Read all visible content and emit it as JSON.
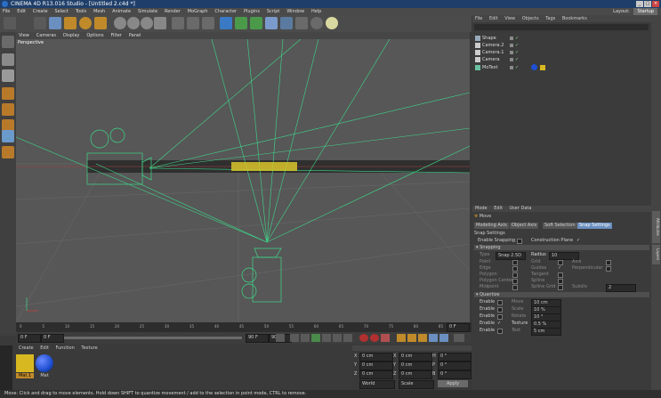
{
  "window": {
    "title": "CINEMA 4D R13.016 Studio - [Untitled 2.c4d *]"
  },
  "menubar": {
    "items": [
      "File",
      "Edit",
      "Create",
      "Select",
      "Tools",
      "Mesh",
      "Animate",
      "Simulate",
      "Render",
      "MoGraph",
      "Character",
      "Plugins",
      "Script",
      "Window",
      "Help"
    ],
    "layout_label": "Layout:",
    "layout_value": "Startup"
  },
  "viewport": {
    "menu": [
      "View",
      "Cameras",
      "Display",
      "Options",
      "Filter",
      "Panel"
    ],
    "label": "Perspective"
  },
  "timeline": {
    "ticks": [
      "0",
      "5",
      "10",
      "15",
      "20",
      "25",
      "30",
      "35",
      "40",
      "45",
      "50",
      "55",
      "60",
      "65",
      "70",
      "75",
      "80",
      "85",
      "90"
    ],
    "current_frame": "0 F"
  },
  "transport": {
    "start_field": "0 F",
    "end_field": "90 F",
    "min_field": "0 F",
    "max_field": "90 F"
  },
  "material_manager": {
    "menu": [
      "Create",
      "Edit",
      "Function",
      "Texture"
    ],
    "materials": [
      "Mat.1",
      "Mat"
    ],
    "colors": {
      "mat1": "#d8b820",
      "mat2": "#1e4fd0"
    }
  },
  "coordinates": {
    "rows": [
      {
        "axis": "X",
        "pos": "0 cm",
        "size": "0 cm",
        "rot_label": "H",
        "rot": "0 °"
      },
      {
        "axis": "Y",
        "pos": "0 cm",
        "size": "0 cm",
        "rot_label": "P",
        "rot": "0 °"
      },
      {
        "axis": "Z",
        "pos": "0 cm",
        "size": "0 cm",
        "rot_label": "B",
        "rot": "0 °"
      }
    ],
    "mode": "World",
    "scale_mode": "Scale",
    "apply": "Apply"
  },
  "object_manager": {
    "menu": [
      "File",
      "Edit",
      "View",
      "Objects",
      "Tags",
      "Bookmarks"
    ],
    "objects": [
      {
        "name": "Shape"
      },
      {
        "name": "Camera.2"
      },
      {
        "name": "Camera.1"
      },
      {
        "name": "Camera"
      },
      {
        "name": "MoText"
      }
    ]
  },
  "attributes": {
    "menu": [
      "Mode",
      "Edit",
      "User Data"
    ],
    "tool_name": "Move",
    "tabs": [
      "Modeling Axis",
      "Object Axis",
      "Soft Selection",
      "Snap Settings"
    ],
    "section_title": "Snap Settings",
    "enable_snapping": "Enable Snapping",
    "construction_plane": "Construction Plane",
    "snapping_header": "Snapping",
    "type_label": "Type",
    "type_value": "Snap 2.5D",
    "radius_label": "Radius",
    "radius_value": "10",
    "snap_left": [
      "Point",
      "Edge",
      "Polygon",
      "Polygon Center",
      "Midpoint"
    ],
    "snap_mid": [
      "Grid",
      "Guides",
      "Tangent",
      "Spline",
      "Spline Grid"
    ],
    "snap_right": [
      "Axis",
      "Perpendicular",
      "",
      "",
      "Subdiv"
    ],
    "subdiv_value": "2",
    "quantize_header": "Quantize",
    "quantize_rows": [
      {
        "label": "Enable",
        "name": "Move",
        "value": "10 cm"
      },
      {
        "label": "Enable",
        "name": "Scale",
        "value": "10 %"
      },
      {
        "label": "Enable",
        "name": "Rotate",
        "value": "10 °"
      },
      {
        "label": "Enable",
        "name": "Texture",
        "value": "0.5 %"
      },
      {
        "label": "Enable",
        "name": "Text",
        "value": "5 cm"
      }
    ]
  },
  "right_tabs": [
    "Attributes",
    "Layers"
  ],
  "statusbar": {
    "text": "Move: Click and drag to move elements. Hold down SHIFT to quantize movement / add to the selection in point mode, CTRL to remove."
  }
}
